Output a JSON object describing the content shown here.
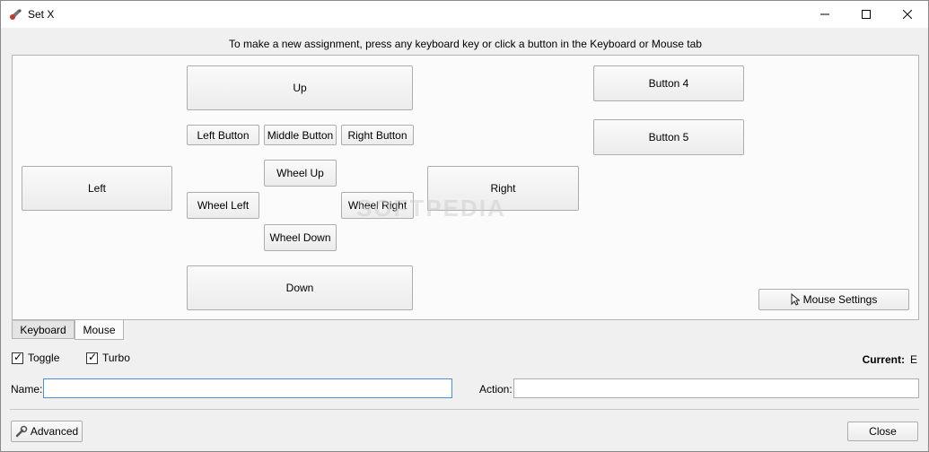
{
  "window": {
    "title": "Set X",
    "minimize_glyph": "—",
    "maximize_glyph": "☐",
    "close_glyph": "✕"
  },
  "instruction": "To make a new assignment, press any keyboard key or click a button in the Keyboard or Mouse tab",
  "mouse_panel": {
    "up": "Up",
    "down": "Down",
    "left": "Left",
    "right": "Right",
    "left_button": "Left Button",
    "middle_button": "Middle Button",
    "right_button": "Right Button",
    "wheel_up": "Wheel Up",
    "wheel_left": "Wheel Left",
    "wheel_right": "Wheel Right",
    "wheel_down": "Wheel Down",
    "button4": "Button 4",
    "button5": "Button 5",
    "mouse_settings": "Mouse Settings",
    "watermark": "SOFTPEDIA"
  },
  "tabs": [
    {
      "label": "Keyboard",
      "active": false
    },
    {
      "label": "Mouse",
      "active": true
    }
  ],
  "options": {
    "toggle": {
      "label": "Toggle",
      "checked": true
    },
    "turbo": {
      "label": "Turbo",
      "checked": true
    }
  },
  "current": {
    "label": "Current:",
    "value": "E"
  },
  "name_field": {
    "label": "Name:",
    "value": ""
  },
  "action_field": {
    "label": "Action:",
    "value": ""
  },
  "footer": {
    "advanced": "Advanced",
    "close": "Close"
  },
  "colors": {
    "focus_border": "#4b90d4",
    "panel_bg": "#fbfbfb",
    "window_bg": "#f0f0f0"
  }
}
